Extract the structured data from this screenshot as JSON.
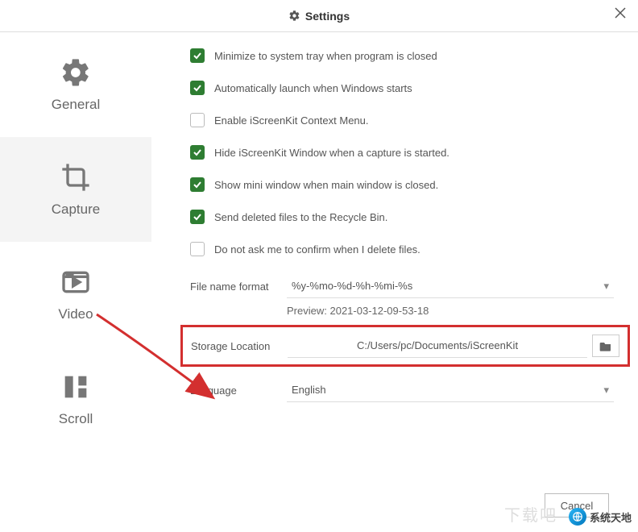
{
  "header": {
    "title": "Settings"
  },
  "sidebar": {
    "items": [
      {
        "label": "General"
      },
      {
        "label": "Capture"
      },
      {
        "label": "Video"
      },
      {
        "label": "Scroll"
      }
    ]
  },
  "options": {
    "minimize_tray": "Minimize to system tray when program is closed",
    "auto_launch": "Automatically launch when Windows starts",
    "context_menu": "Enable iScreenKit Context Menu.",
    "hide_window": "Hide iScreenKit Window when a capture is started.",
    "show_mini": "Show mini window when main window is closed.",
    "recycle_bin": "Send deleted files to the Recycle Bin.",
    "no_confirm": "Do not ask me to confirm when I delete files."
  },
  "filename": {
    "label": "File name format",
    "value": "%y-%mo-%d-%h-%mi-%s",
    "preview_label": "Preview:",
    "preview_value": "2021-03-12-09-53-18"
  },
  "storage": {
    "label": "Storage Location",
    "value": "C:/Users/pc/Documents/iScreenKit"
  },
  "language": {
    "label": "Language",
    "value": "English"
  },
  "buttons": {
    "cancel": "Cancel"
  },
  "watermark": {
    "text": "系统天地"
  }
}
